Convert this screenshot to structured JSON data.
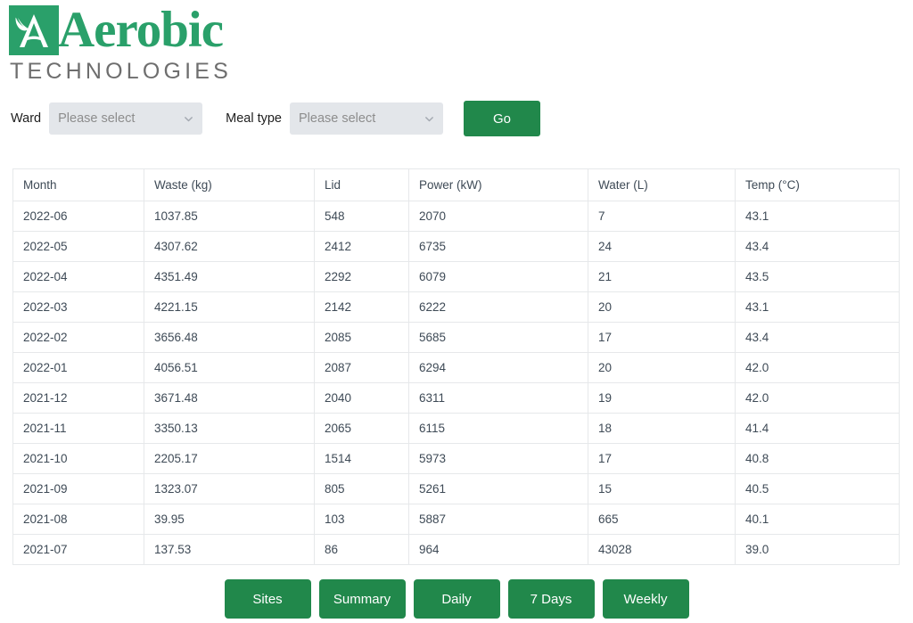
{
  "brand": {
    "name": "Aerobic",
    "subtitle": "TECHNOLOGIES",
    "logo_icon": "aerobic-a-leaf-logo",
    "green": "#2aa06a"
  },
  "filters": {
    "ward": {
      "label": "Ward",
      "value": "",
      "placeholder": "Please select",
      "chevron_icon": "chevron-down-icon"
    },
    "meal_type": {
      "label": "Meal type",
      "value": "",
      "placeholder": "Please select",
      "chevron_icon": "chevron-down-icon"
    },
    "go_label": "Go",
    "button_color": "#21884b"
  },
  "table": {
    "columns": [
      "Month",
      "Waste (kg)",
      "Lid",
      "Power (kW)",
      "Water (L)",
      "Temp (°C)"
    ],
    "rows": [
      [
        "2022-06",
        "1037.85",
        "548",
        "2070",
        "7",
        "43.1"
      ],
      [
        "2022-05",
        "4307.62",
        "2412",
        "6735",
        "24",
        "43.4"
      ],
      [
        "2022-04",
        "4351.49",
        "2292",
        "6079",
        "21",
        "43.5"
      ],
      [
        "2022-03",
        "4221.15",
        "2142",
        "6222",
        "20",
        "43.1"
      ],
      [
        "2022-02",
        "3656.48",
        "2085",
        "5685",
        "17",
        "43.4"
      ],
      [
        "2022-01",
        "4056.51",
        "2087",
        "6294",
        "20",
        "42.0"
      ],
      [
        "2021-12",
        "3671.48",
        "2040",
        "6311",
        "19",
        "42.0"
      ],
      [
        "2021-11",
        "3350.13",
        "2065",
        "6115",
        "18",
        "41.4"
      ],
      [
        "2021-10",
        "2205.17",
        "1514",
        "5973",
        "17",
        "40.8"
      ],
      [
        "2021-09",
        "1323.07",
        "805",
        "5261",
        "15",
        "40.5"
      ],
      [
        "2021-08",
        "39.95",
        "103",
        "5887",
        "665",
        "40.1"
      ],
      [
        "2021-07",
        "137.53",
        "86",
        "964",
        "43028",
        "39.0"
      ]
    ]
  },
  "nav_buttons": [
    {
      "label": "Sites"
    },
    {
      "label": "Summary"
    },
    {
      "label": "Daily"
    },
    {
      "label": "7 Days"
    },
    {
      "label": "Weekly"
    }
  ]
}
